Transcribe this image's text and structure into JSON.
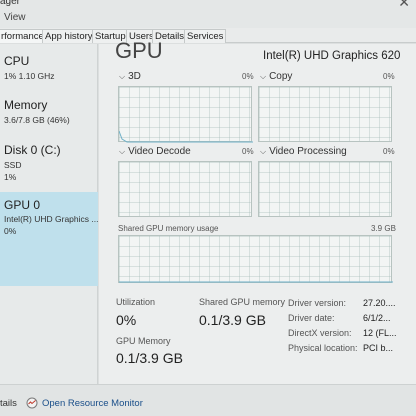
{
  "window": {
    "title_fragment": "ager",
    "close_glyph": "✕"
  },
  "menu": {
    "view": "View"
  },
  "tabs": [
    {
      "label": "rformance",
      "active": true
    },
    {
      "label": "App history"
    },
    {
      "label": "Startup"
    },
    {
      "label": "Users"
    },
    {
      "label": "Details"
    },
    {
      "label": "Services"
    }
  ],
  "sidebar": {
    "items": [
      {
        "name": "CPU",
        "line1": "1%  1.10 GHz",
        "line2": ""
      },
      {
        "name": "Memory",
        "line1": "3.6/7.8 GB (46%)",
        "line2": ""
      },
      {
        "name": "Disk 0 (C:)",
        "line1": "SSD",
        "line2": "1%"
      },
      {
        "name": "GPU 0",
        "line1": "Intel(R) UHD Graphics ...",
        "line2": "0%",
        "selected": true
      }
    ]
  },
  "main": {
    "title": "GPU",
    "model": "Intel(R) UHD Graphics 620",
    "graphs": [
      {
        "label": "3D",
        "pct": "0%"
      },
      {
        "label": "Copy",
        "pct": "0%"
      },
      {
        "label": "Video Decode",
        "pct": "0%"
      },
      {
        "label": "Video Processing",
        "pct": "0%"
      }
    ],
    "shared_usage": {
      "label": "Shared GPU memory usage",
      "max": "3.9 GB"
    },
    "stats": {
      "utilization_label": "Utilization",
      "utilization_value": "0%",
      "shared_mem_label": "Shared GPU memory",
      "shared_mem_value": "0.1/3.9 GB",
      "gpu_mem_label": "GPU Memory",
      "gpu_mem_value": "0.1/3.9 GB"
    },
    "info": {
      "driver_version_label": "Driver version:",
      "driver_version_value": "27.20....",
      "driver_date_label": "Driver date:",
      "driver_date_value": "6/1/2...",
      "directx_label": "DirectX version:",
      "directx_value": "12 (FL...",
      "location_label": "Physical location:",
      "location_value": "PCI b..."
    }
  },
  "footer": {
    "details": "tails",
    "monitor_link": "Open Resource Monitor",
    "monitor_icon": "resource-monitor-icon"
  },
  "colors": {
    "accent_selected": "#bfe0ec",
    "graph_border": "#b7c3c0",
    "link": "#1a4f8a"
  }
}
